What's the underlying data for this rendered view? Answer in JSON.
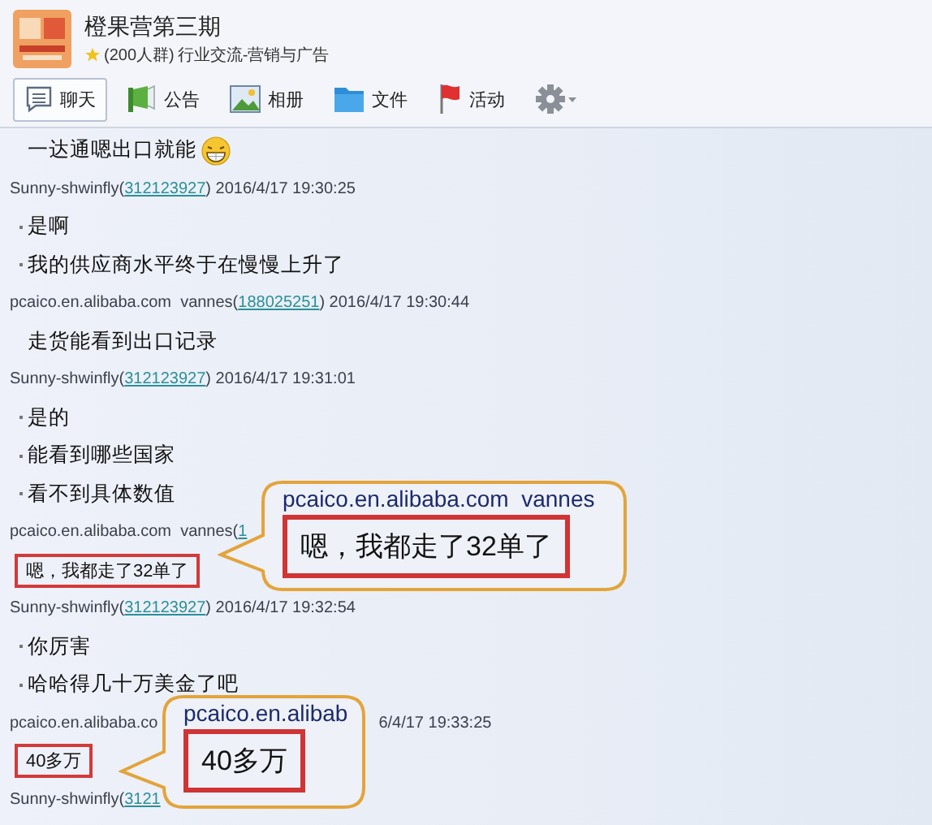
{
  "group": {
    "name": "橙果营第三期",
    "member_count": "(200人群)",
    "category": "行业交流-营销与广告"
  },
  "toolbar": [
    {
      "kind": "chat",
      "label": "聊天",
      "selected": true
    },
    {
      "kind": "notice",
      "label": "公告",
      "selected": false
    },
    {
      "kind": "album",
      "label": "相册",
      "selected": false
    },
    {
      "kind": "file",
      "label": "文件",
      "selected": false
    },
    {
      "kind": "event",
      "label": "活动",
      "selected": false
    },
    {
      "kind": "settings",
      "selected": false
    }
  ],
  "messages": [
    {
      "kind": "text",
      "text": "一达通嗯出口就能",
      "bullet": false,
      "emoji": true,
      "highlight": false
    },
    {
      "kind": "header",
      "sender": "Sunny-shwinfly(",
      "id": "312123927",
      "time": ") 2016/4/17 19:30:25"
    },
    {
      "kind": "text",
      "text": "是啊",
      "bullet": true,
      "emoji": false,
      "highlight": false
    },
    {
      "kind": "text",
      "text": "我的供应商水平终于在慢慢上升了",
      "bullet": true,
      "emoji": false,
      "highlight": false
    },
    {
      "kind": "header",
      "sender": "pcaico.en.alibaba.com  vannes(",
      "id": "188025251",
      "time": ") 2016/4/17 19:30:44"
    },
    {
      "kind": "text",
      "text": "走货能看到出口记录",
      "bullet": false,
      "emoji": false,
      "highlight": false
    },
    {
      "kind": "header",
      "sender": "Sunny-shwinfly(",
      "id": "312123927",
      "time": ") 2016/4/17 19:31:01"
    },
    {
      "kind": "text",
      "text": "是的",
      "bullet": true,
      "emoji": false,
      "highlight": false
    },
    {
      "kind": "text",
      "text": "能看到哪些国家",
      "bullet": true,
      "emoji": false,
      "highlight": false
    },
    {
      "kind": "text",
      "text": "看不到具体数值",
      "bullet": true,
      "emoji": false,
      "highlight": false
    },
    {
      "kind": "header",
      "sender": "pcaico.en.alibaba.com  vannes(",
      "id": "1"
    },
    {
      "kind": "text",
      "text": "嗯，我都走了32单了",
      "bullet": false,
      "emoji": false,
      "highlight": true
    },
    {
      "kind": "header",
      "sender": "Sunny-shwinfly(",
      "id": "312123927",
      "time": ") 2016/4/17 19:32:54"
    },
    {
      "kind": "text",
      "text": "你厉害",
      "bullet": true,
      "emoji": false,
      "highlight": false
    },
    {
      "kind": "text",
      "text": "哈哈得几十万美金了吧",
      "bullet": true,
      "emoji": false,
      "highlight": false
    },
    {
      "kind": "header",
      "sender": "pcaico.en.alibaba.co",
      "time": "6/4/17 19:33:25",
      "gap": true
    },
    {
      "kind": "text",
      "text": "40多万",
      "bullet": false,
      "emoji": false,
      "highlight": true
    },
    {
      "kind": "header",
      "sender": "Sunny-shwinfly(",
      "id": "3121"
    }
  ],
  "callouts": [
    {
      "sender": "pcaico.en.alibaba.com  vannes",
      "text": "嗯，我都走了32单了"
    },
    {
      "sender": "pcaico.en.alibab",
      "text": "40多万"
    }
  ]
}
